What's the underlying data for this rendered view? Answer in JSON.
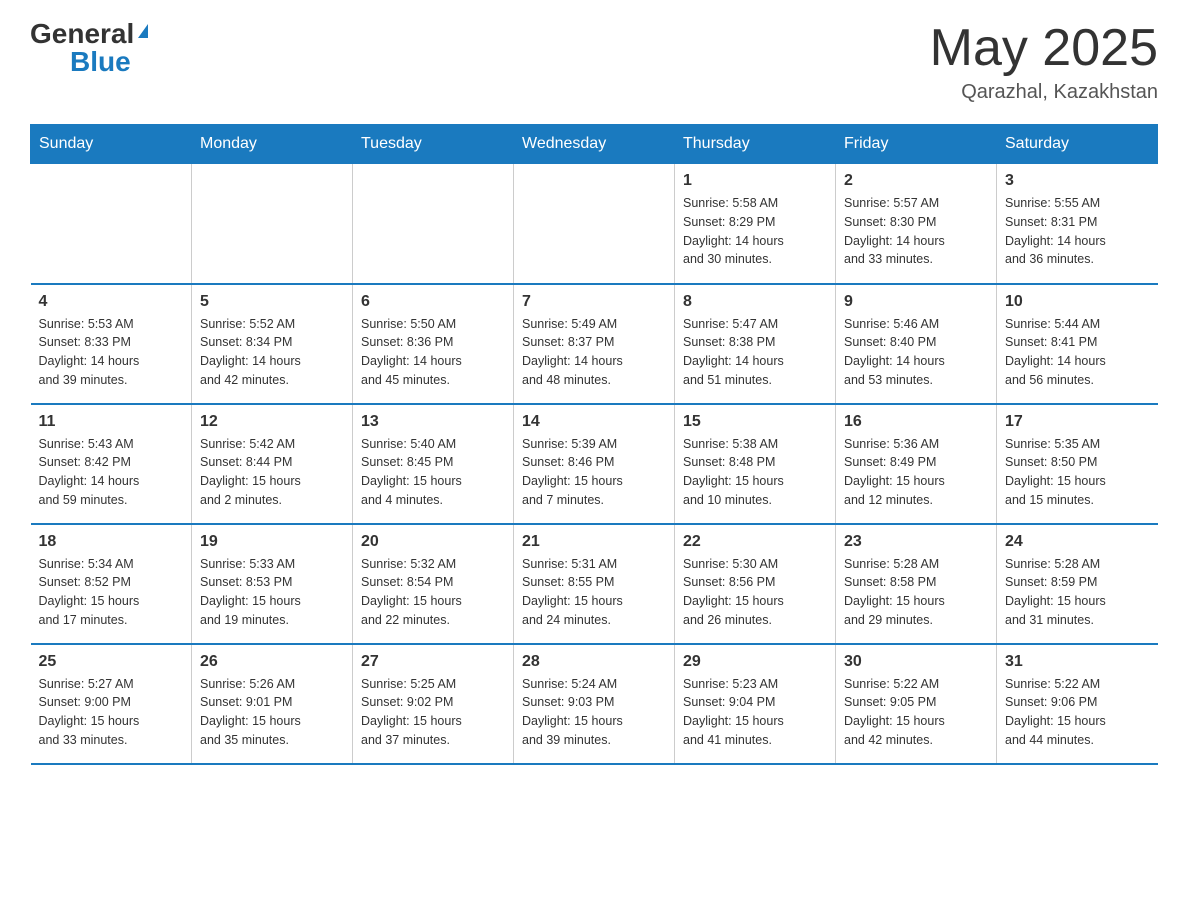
{
  "header": {
    "logo_general": "General",
    "logo_blue": "Blue",
    "month_title": "May 2025",
    "location": "Qarazhal, Kazakhstan"
  },
  "days_of_week": [
    "Sunday",
    "Monday",
    "Tuesday",
    "Wednesday",
    "Thursday",
    "Friday",
    "Saturday"
  ],
  "weeks": [
    [
      {
        "day": "",
        "info": ""
      },
      {
        "day": "",
        "info": ""
      },
      {
        "day": "",
        "info": ""
      },
      {
        "day": "",
        "info": ""
      },
      {
        "day": "1",
        "info": "Sunrise: 5:58 AM\nSunset: 8:29 PM\nDaylight: 14 hours\nand 30 minutes."
      },
      {
        "day": "2",
        "info": "Sunrise: 5:57 AM\nSunset: 8:30 PM\nDaylight: 14 hours\nand 33 minutes."
      },
      {
        "day": "3",
        "info": "Sunrise: 5:55 AM\nSunset: 8:31 PM\nDaylight: 14 hours\nand 36 minutes."
      }
    ],
    [
      {
        "day": "4",
        "info": "Sunrise: 5:53 AM\nSunset: 8:33 PM\nDaylight: 14 hours\nand 39 minutes."
      },
      {
        "day": "5",
        "info": "Sunrise: 5:52 AM\nSunset: 8:34 PM\nDaylight: 14 hours\nand 42 minutes."
      },
      {
        "day": "6",
        "info": "Sunrise: 5:50 AM\nSunset: 8:36 PM\nDaylight: 14 hours\nand 45 minutes."
      },
      {
        "day": "7",
        "info": "Sunrise: 5:49 AM\nSunset: 8:37 PM\nDaylight: 14 hours\nand 48 minutes."
      },
      {
        "day": "8",
        "info": "Sunrise: 5:47 AM\nSunset: 8:38 PM\nDaylight: 14 hours\nand 51 minutes."
      },
      {
        "day": "9",
        "info": "Sunrise: 5:46 AM\nSunset: 8:40 PM\nDaylight: 14 hours\nand 53 minutes."
      },
      {
        "day": "10",
        "info": "Sunrise: 5:44 AM\nSunset: 8:41 PM\nDaylight: 14 hours\nand 56 minutes."
      }
    ],
    [
      {
        "day": "11",
        "info": "Sunrise: 5:43 AM\nSunset: 8:42 PM\nDaylight: 14 hours\nand 59 minutes."
      },
      {
        "day": "12",
        "info": "Sunrise: 5:42 AM\nSunset: 8:44 PM\nDaylight: 15 hours\nand 2 minutes."
      },
      {
        "day": "13",
        "info": "Sunrise: 5:40 AM\nSunset: 8:45 PM\nDaylight: 15 hours\nand 4 minutes."
      },
      {
        "day": "14",
        "info": "Sunrise: 5:39 AM\nSunset: 8:46 PM\nDaylight: 15 hours\nand 7 minutes."
      },
      {
        "day": "15",
        "info": "Sunrise: 5:38 AM\nSunset: 8:48 PM\nDaylight: 15 hours\nand 10 minutes."
      },
      {
        "day": "16",
        "info": "Sunrise: 5:36 AM\nSunset: 8:49 PM\nDaylight: 15 hours\nand 12 minutes."
      },
      {
        "day": "17",
        "info": "Sunrise: 5:35 AM\nSunset: 8:50 PM\nDaylight: 15 hours\nand 15 minutes."
      }
    ],
    [
      {
        "day": "18",
        "info": "Sunrise: 5:34 AM\nSunset: 8:52 PM\nDaylight: 15 hours\nand 17 minutes."
      },
      {
        "day": "19",
        "info": "Sunrise: 5:33 AM\nSunset: 8:53 PM\nDaylight: 15 hours\nand 19 minutes."
      },
      {
        "day": "20",
        "info": "Sunrise: 5:32 AM\nSunset: 8:54 PM\nDaylight: 15 hours\nand 22 minutes."
      },
      {
        "day": "21",
        "info": "Sunrise: 5:31 AM\nSunset: 8:55 PM\nDaylight: 15 hours\nand 24 minutes."
      },
      {
        "day": "22",
        "info": "Sunrise: 5:30 AM\nSunset: 8:56 PM\nDaylight: 15 hours\nand 26 minutes."
      },
      {
        "day": "23",
        "info": "Sunrise: 5:28 AM\nSunset: 8:58 PM\nDaylight: 15 hours\nand 29 minutes."
      },
      {
        "day": "24",
        "info": "Sunrise: 5:28 AM\nSunset: 8:59 PM\nDaylight: 15 hours\nand 31 minutes."
      }
    ],
    [
      {
        "day": "25",
        "info": "Sunrise: 5:27 AM\nSunset: 9:00 PM\nDaylight: 15 hours\nand 33 minutes."
      },
      {
        "day": "26",
        "info": "Sunrise: 5:26 AM\nSunset: 9:01 PM\nDaylight: 15 hours\nand 35 minutes."
      },
      {
        "day": "27",
        "info": "Sunrise: 5:25 AM\nSunset: 9:02 PM\nDaylight: 15 hours\nand 37 minutes."
      },
      {
        "day": "28",
        "info": "Sunrise: 5:24 AM\nSunset: 9:03 PM\nDaylight: 15 hours\nand 39 minutes."
      },
      {
        "day": "29",
        "info": "Sunrise: 5:23 AM\nSunset: 9:04 PM\nDaylight: 15 hours\nand 41 minutes."
      },
      {
        "day": "30",
        "info": "Sunrise: 5:22 AM\nSunset: 9:05 PM\nDaylight: 15 hours\nand 42 minutes."
      },
      {
        "day": "31",
        "info": "Sunrise: 5:22 AM\nSunset: 9:06 PM\nDaylight: 15 hours\nand 44 minutes."
      }
    ]
  ]
}
